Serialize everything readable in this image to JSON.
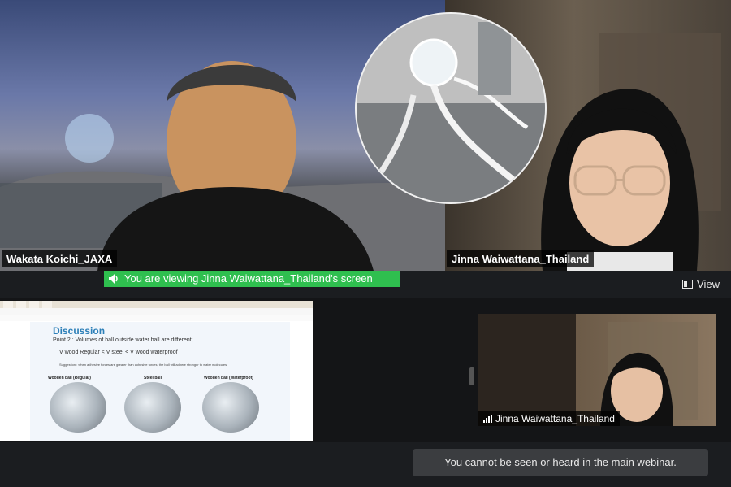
{
  "participants": {
    "left": {
      "name": "Wakata Koichi_JAXA"
    },
    "right": {
      "name": "Jinna Waiwattana_Thailand"
    }
  },
  "share_banner": {
    "text": "You are viewing Jinna Waiwattana_Thailand's screen"
  },
  "view_button": {
    "label": "View"
  },
  "shared_screen": {
    "slide": {
      "title": "Discussion",
      "subtitle": "Point 2 : Volumes of ball outside water ball are different;",
      "equation": "V wood Regular < V steel < V wood waterproof",
      "note": "Suggestion : when adhesive forces are greater than cohesive forces, the ball will adhere stronger to water molecules.",
      "labels": [
        "Wooden ball (Regular)",
        "Steel ball",
        "Wooden ball (Waterproof)"
      ]
    }
  },
  "pip": {
    "name": "Jinna Waiwattana_Thailand"
  },
  "toast": {
    "text": "You cannot be seen or heard in the main webinar."
  },
  "colors": {
    "banner": "#2fbf4f",
    "slide_title": "#2c7fb8"
  }
}
